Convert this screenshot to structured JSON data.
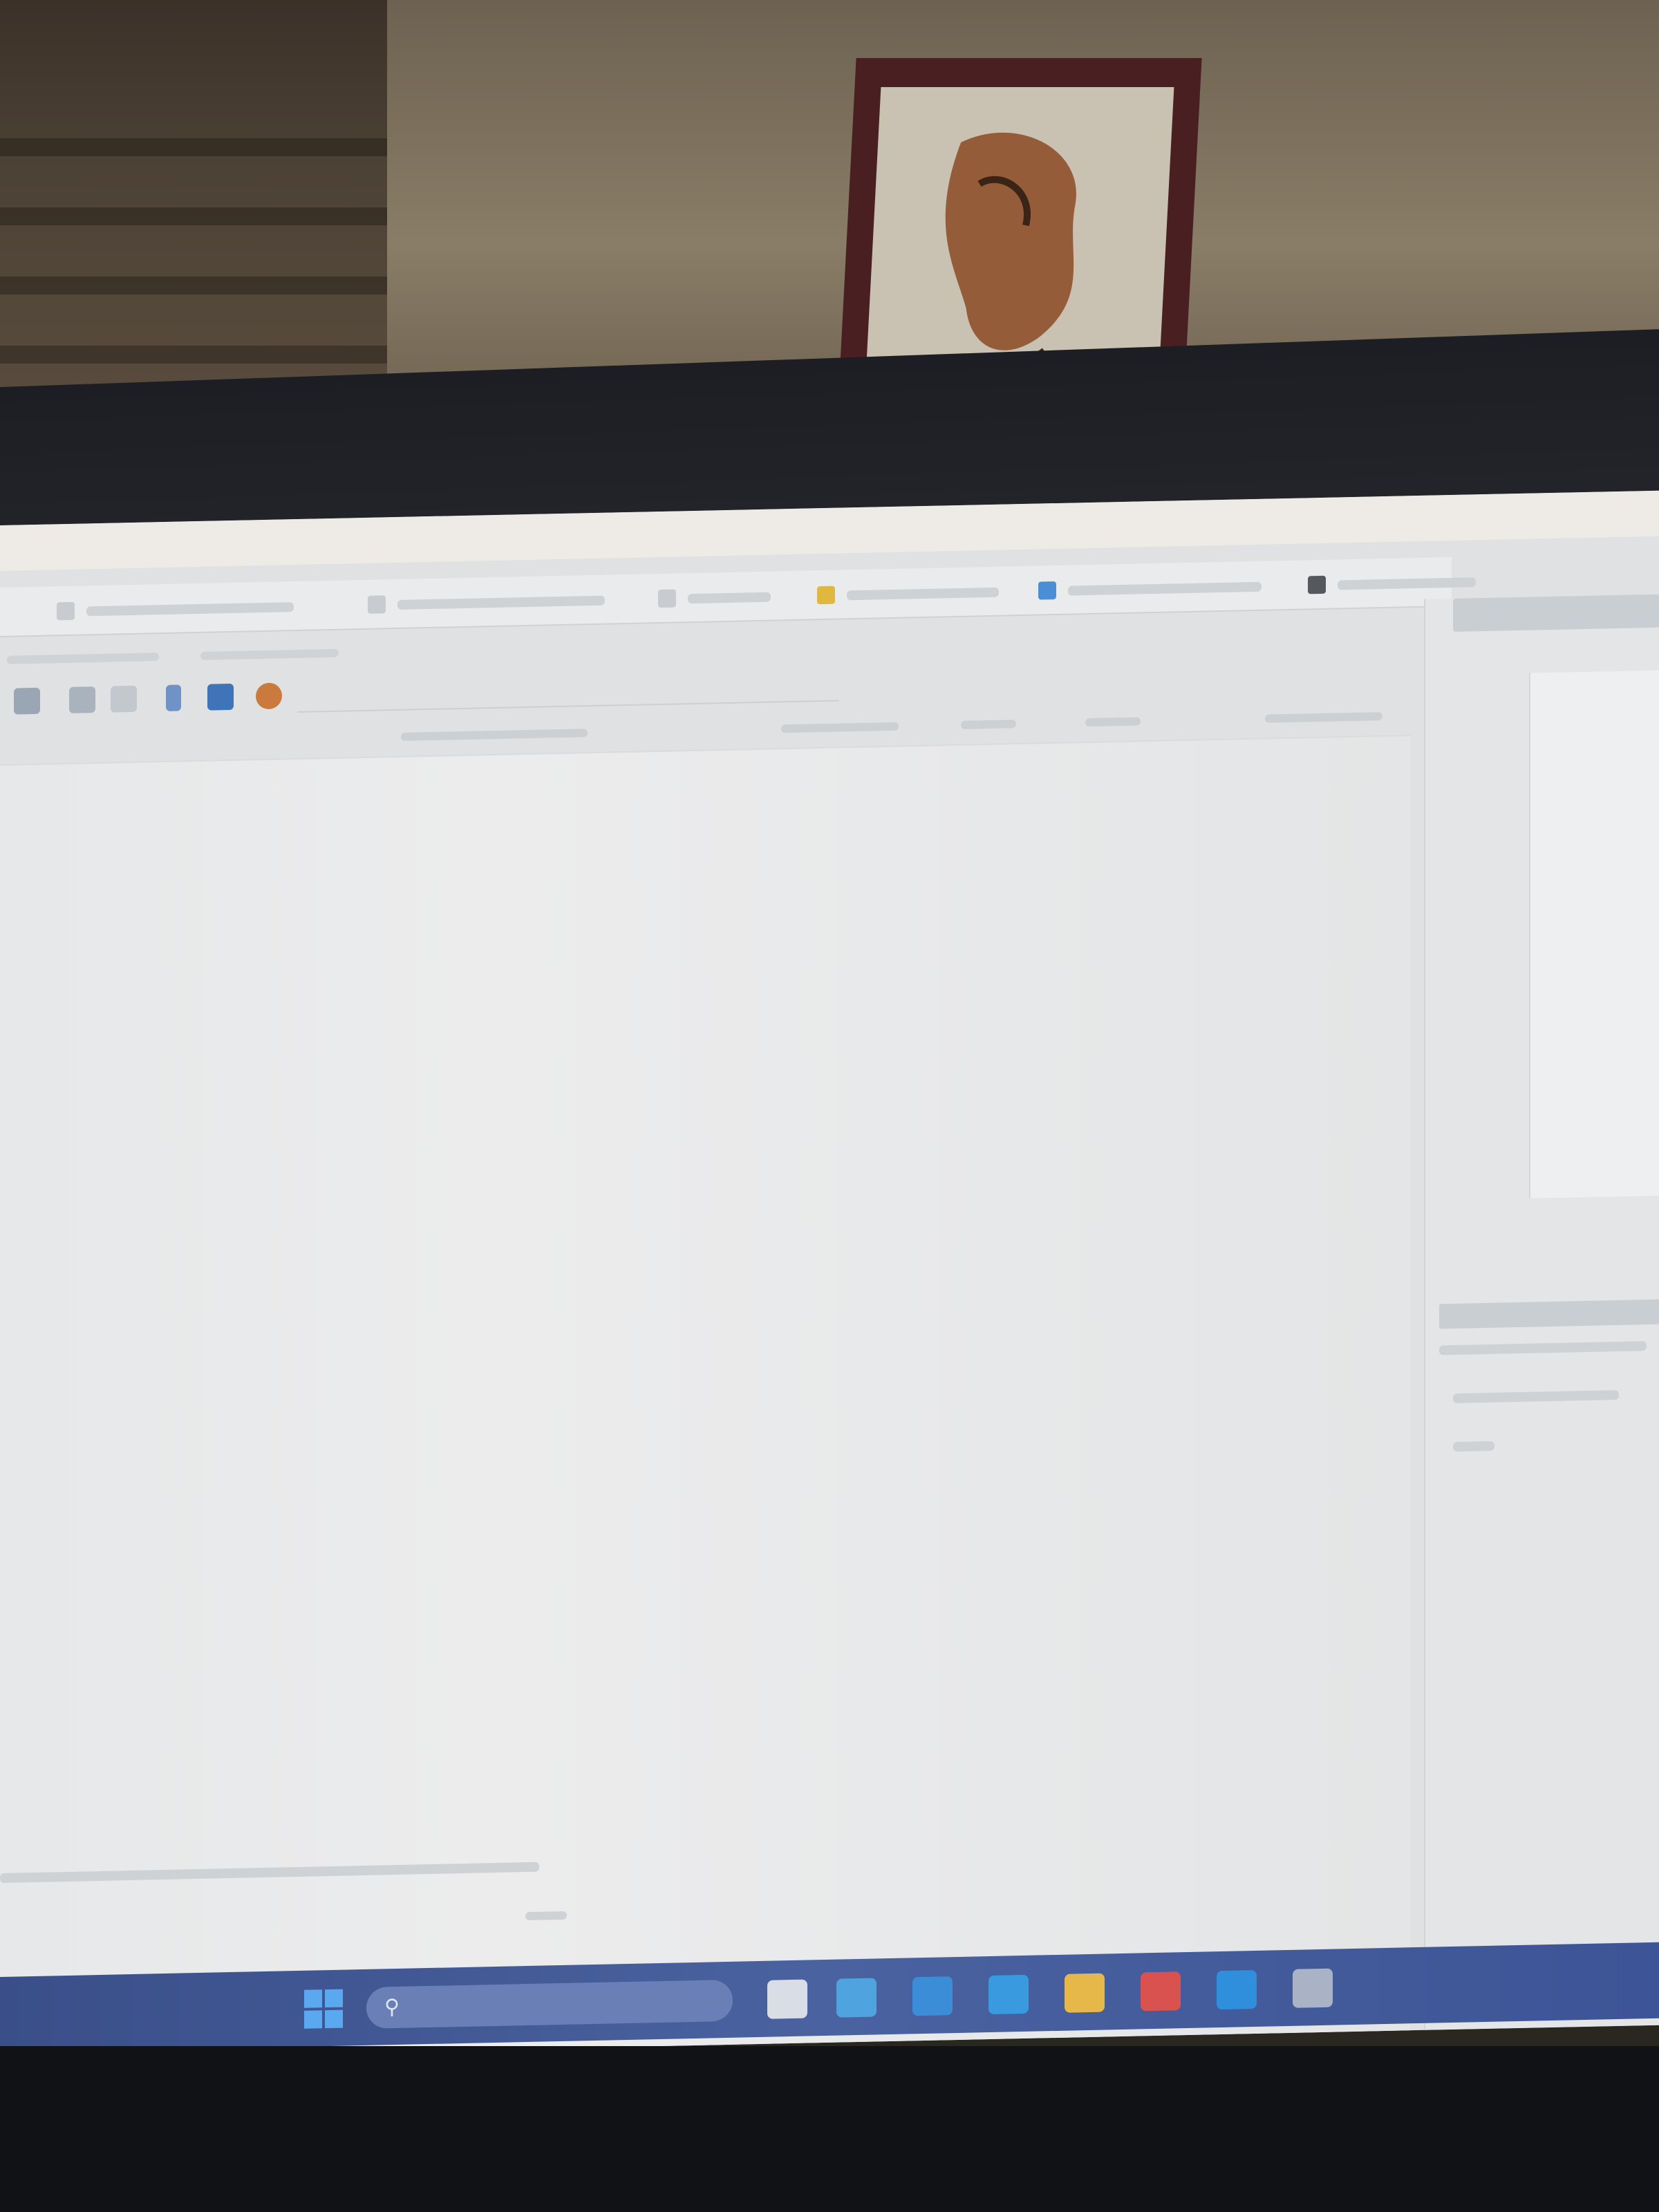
{
  "window": {
    "title": ""
  },
  "toolbar": {
    "buttons": [
      {
        "label": "",
        "icon": "edit-icon"
      },
      {
        "label": "",
        "icon": "discard-icon"
      },
      {
        "label": "",
        "icon": "refresh-icon"
      },
      {
        "label": "",
        "icon": "export-icon"
      },
      {
        "label": "",
        "icon": "import-icon"
      },
      {
        "label": "",
        "icon": "lock-icon"
      }
    ]
  },
  "subtabs": [
    "",
    ""
  ],
  "filter": {
    "placeholder": ""
  },
  "table": {
    "columns": [
      "",
      "",
      "",
      "",
      "",
      ""
    ],
    "rows": []
  },
  "right_panel": {
    "header": "",
    "labels": [
      "",
      "",
      ""
    ],
    "section_bar": ""
  },
  "taskbar": {
    "search_placeholder": "",
    "apps": [
      "start-icon",
      "task-view-icon",
      "widgets-icon",
      "chat-icon",
      "edge-icon",
      "file-explorer-icon",
      "store-icon",
      "vscode-icon",
      "settings-icon"
    ]
  },
  "colors": {
    "taskbar": "#3a4f8a",
    "screen_bg": "#dfe1e2",
    "accent_yellow": "#e0b840",
    "accent_blue": "#4a8fd6"
  }
}
